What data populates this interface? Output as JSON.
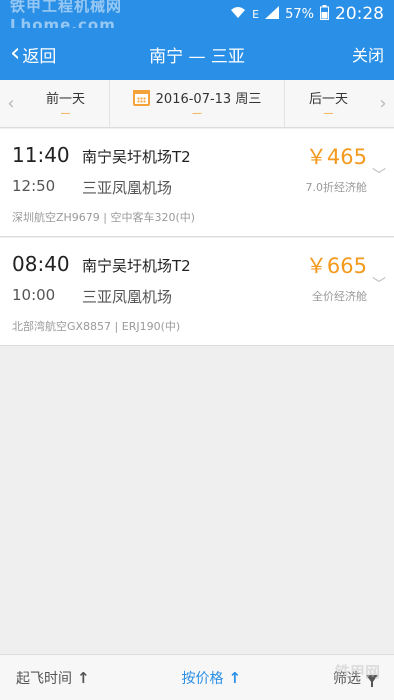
{
  "status_bar": {
    "watermark": "铁甲工程机械网 Lhome.com",
    "signal_letter": "E",
    "battery": "57%",
    "time": "20:28"
  },
  "nav": {
    "back_label": "返回",
    "title": "南宁 — 三亚",
    "close_label": "关闭"
  },
  "date_bar": {
    "prev_label": "前一天",
    "current_date": "2016-07-13 周三",
    "next_label": "后一天"
  },
  "flights": [
    {
      "dep_time": "11:40",
      "arr_time": "12:50",
      "dep_airport": "南宁吴圩机场T2",
      "arr_airport": "三亚凤凰机场",
      "info": "深圳航空ZH9679 | 空中客车320(中)",
      "price": "￥465",
      "cabin": "7.0折经济舱"
    },
    {
      "dep_time": "08:40",
      "arr_time": "10:00",
      "dep_airport": "南宁吴圩机场T2",
      "arr_airport": "三亚凤凰机场",
      "info": "北部湾航空GX8857 | ERJ190(中)",
      "price": "￥665",
      "cabin": "全价经济舱"
    }
  ],
  "bottom_bar": {
    "sort_time_label": "起飞时间",
    "sort_price_label": "按价格",
    "filter_label": "筛选",
    "watermark": "铁甲网"
  },
  "colors": {
    "accent": "#2a8fe6",
    "price": "#f39a1e"
  }
}
